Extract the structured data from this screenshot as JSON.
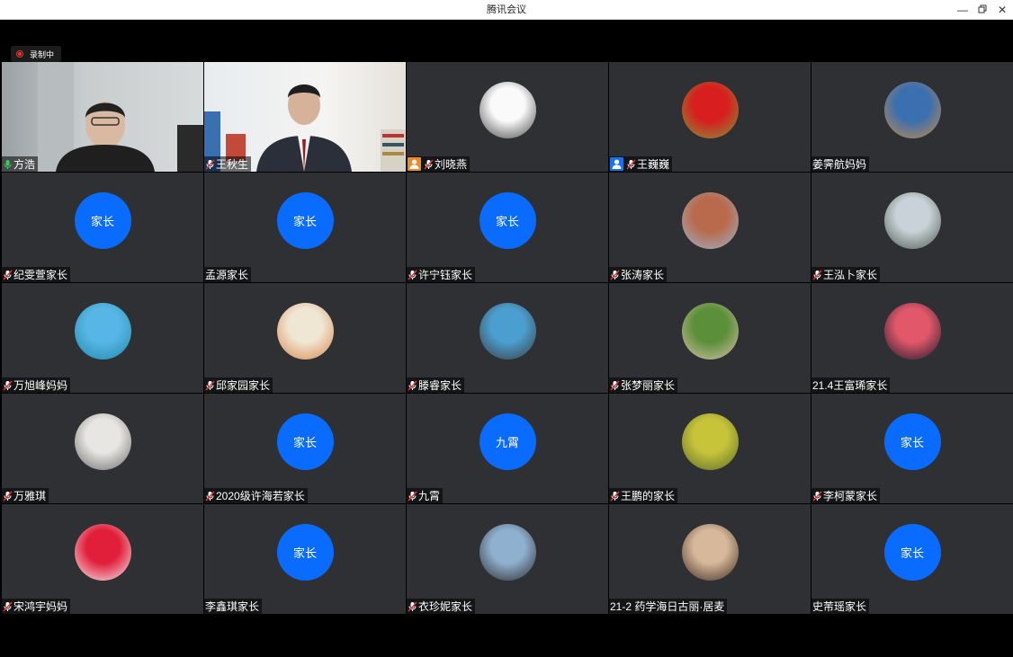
{
  "window": {
    "title": "腾讯会议"
  },
  "recording": {
    "label": "录制中"
  },
  "participants": [
    {
      "name": "方浩",
      "kind": "video",
      "scene": 1,
      "mic": "on"
    },
    {
      "name": "王秋生",
      "kind": "video",
      "scene": 2,
      "mic": "muted"
    },
    {
      "name": "刘晓燕",
      "kind": "photo",
      "mic": "muted",
      "badge": "orange",
      "colors": [
        "#fafafa",
        "#444"
      ]
    },
    {
      "name": "王巍巍",
      "kind": "photo",
      "mic": "muted",
      "badge": "blue",
      "colors": [
        "#d81e1e",
        "#7c9a3a"
      ]
    },
    {
      "name": "姜霁航妈妈",
      "kind": "photo",
      "mic": "none",
      "colors": [
        "#3a6fb0",
        "#c98a4a"
      ]
    },
    {
      "name": "纪雯萱家长",
      "kind": "text",
      "avatar_text": "家长",
      "mic": "muted"
    },
    {
      "name": "孟源家长",
      "kind": "text",
      "avatar_text": "家长",
      "mic": "none"
    },
    {
      "name": "许宁钰家长",
      "kind": "text",
      "avatar_text": "家长",
      "mic": "muted"
    },
    {
      "name": "张涛家长",
      "kind": "photo",
      "mic": "muted",
      "colors": [
        "#b96a4c",
        "#9db3cc"
      ]
    },
    {
      "name": "王泓卜家长",
      "kind": "photo",
      "mic": "muted",
      "colors": [
        "#c9d2d8",
        "#4c5a4c"
      ]
    },
    {
      "name": "万旭峰妈妈",
      "kind": "photo",
      "mic": "muted",
      "colors": [
        "#58b6e6",
        "#1f8aa8"
      ]
    },
    {
      "name": "邱家园家长",
      "kind": "photo",
      "mic": "muted",
      "colors": [
        "#f0e6d4",
        "#d7864a"
      ]
    },
    {
      "name": "滕睿家长",
      "kind": "photo",
      "mic": "muted",
      "colors": [
        "#4b9fd0",
        "#3b3b3b"
      ]
    },
    {
      "name": "张梦丽家长",
      "kind": "photo",
      "mic": "muted",
      "colors": [
        "#5b8f3a",
        "#d8c0a8"
      ]
    },
    {
      "name": "21.4王富琋家长",
      "kind": "photo",
      "mic": "none",
      "colors": [
        "#e0586a",
        "#1a1a2a"
      ]
    },
    {
      "name": "万雅琪",
      "kind": "photo",
      "mic": "muted",
      "colors": [
        "#e8e6e2",
        "#6a6a6a"
      ]
    },
    {
      "name": "2020级许海若家长",
      "kind": "text",
      "avatar_text": "家长",
      "mic": "muted"
    },
    {
      "name": "九霄",
      "kind": "text",
      "avatar_text": "九霄",
      "mic": "muted"
    },
    {
      "name": "王鹏的家长",
      "kind": "photo",
      "mic": "muted",
      "colors": [
        "#c8c43a",
        "#5a6a2a"
      ]
    },
    {
      "name": "李柯蒙家长",
      "kind": "text",
      "avatar_text": "家长",
      "mic": "muted"
    },
    {
      "name": "宋鸿宇妈妈",
      "kind": "photo",
      "mic": "muted",
      "colors": [
        "#e21f3a",
        "#f2f2f2"
      ]
    },
    {
      "name": "李鑫琪家长",
      "kind": "text",
      "avatar_text": "家长",
      "mic": "none"
    },
    {
      "name": "衣珍妮家长",
      "kind": "photo",
      "mic": "muted",
      "colors": [
        "#8fb0cf",
        "#2a2a2a"
      ]
    },
    {
      "name": "21-2 药学海日古丽·居麦",
      "kind": "photo",
      "mic": "none",
      "colors": [
        "#d8b89a",
        "#3a2a22"
      ]
    },
    {
      "name": "史芾瑶家长",
      "kind": "text",
      "avatar_text": "家长",
      "mic": "none"
    }
  ]
}
